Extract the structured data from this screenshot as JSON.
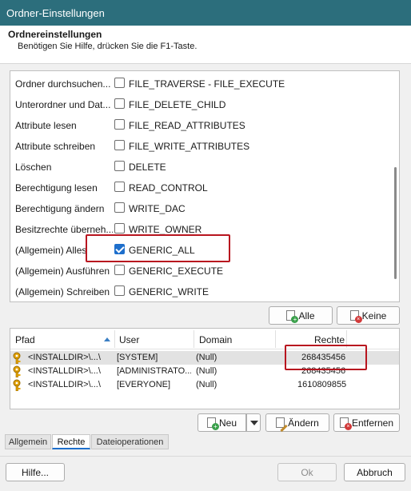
{
  "window": {
    "title": "Ordner-Einstellungen"
  },
  "header": {
    "title": "Ordnereinstellungen",
    "subtitle": "Benötigen Sie Hilfe, drücken Sie die F1-Taste."
  },
  "permissions": [
    {
      "label": "Ordner durchsuchen...",
      "value": "FILE_TRAVERSE - FILE_EXECUTE",
      "checked": false
    },
    {
      "label": "Unterordner und Dat...",
      "value": "FILE_DELETE_CHILD",
      "checked": false
    },
    {
      "label": "Attribute lesen",
      "value": "FILE_READ_ATTRIBUTES",
      "checked": false
    },
    {
      "label": "Attribute schreiben",
      "value": "FILE_WRITE_ATTRIBUTES",
      "checked": false
    },
    {
      "label": "Löschen",
      "value": "DELETE",
      "checked": false
    },
    {
      "label": "Berechtigung lesen",
      "value": "READ_CONTROL",
      "checked": false
    },
    {
      "label": "Berechtigung ändern",
      "value": "WRITE_DAC",
      "checked": false
    },
    {
      "label": "Besitzrechte überneh...",
      "value": "WRITE_OWNER",
      "checked": false
    },
    {
      "label": "(Allgemein) Alles",
      "value": "GENERIC_ALL",
      "checked": true
    },
    {
      "label": "(Allgemein) Ausführen",
      "value": "GENERIC_EXECUTE",
      "checked": false
    },
    {
      "label": "(Allgemein) Schreiben",
      "value": "GENERIC_WRITE",
      "checked": false
    }
  ],
  "perm_buttons": {
    "all": "Alle",
    "none": "Keine"
  },
  "table": {
    "columns": [
      "Pfad",
      "User",
      "Domain",
      "Rechte"
    ],
    "rows": [
      {
        "pfad": "<INSTALLDIR>\\...\\",
        "user": "[SYSTEM]",
        "domain": "(Null)",
        "rechte": "268435456"
      },
      {
        "pfad": "<INSTALLDIR>\\...\\",
        "user": "[ADMINISTRATO...",
        "domain": "(Null)",
        "rechte": "268435456"
      },
      {
        "pfad": "<INSTALLDIR>\\...\\",
        "user": "[EVERYONE]",
        "domain": "(Null)",
        "rechte": "1610809855"
      }
    ]
  },
  "list_buttons": {
    "new": "Neu",
    "edit": "Ändern",
    "remove": "Entfernen"
  },
  "tabs": [
    "Allgemein",
    "Rechte",
    "Dateioperationen"
  ],
  "active_tab": "Rechte",
  "footer": {
    "help": "Hilfe...",
    "ok": "Ok",
    "cancel": "Abbruch"
  },
  "colors": {
    "titlebar": "#2c6e7c",
    "accent": "#1e6fcc",
    "highlight": "#b8151f"
  }
}
